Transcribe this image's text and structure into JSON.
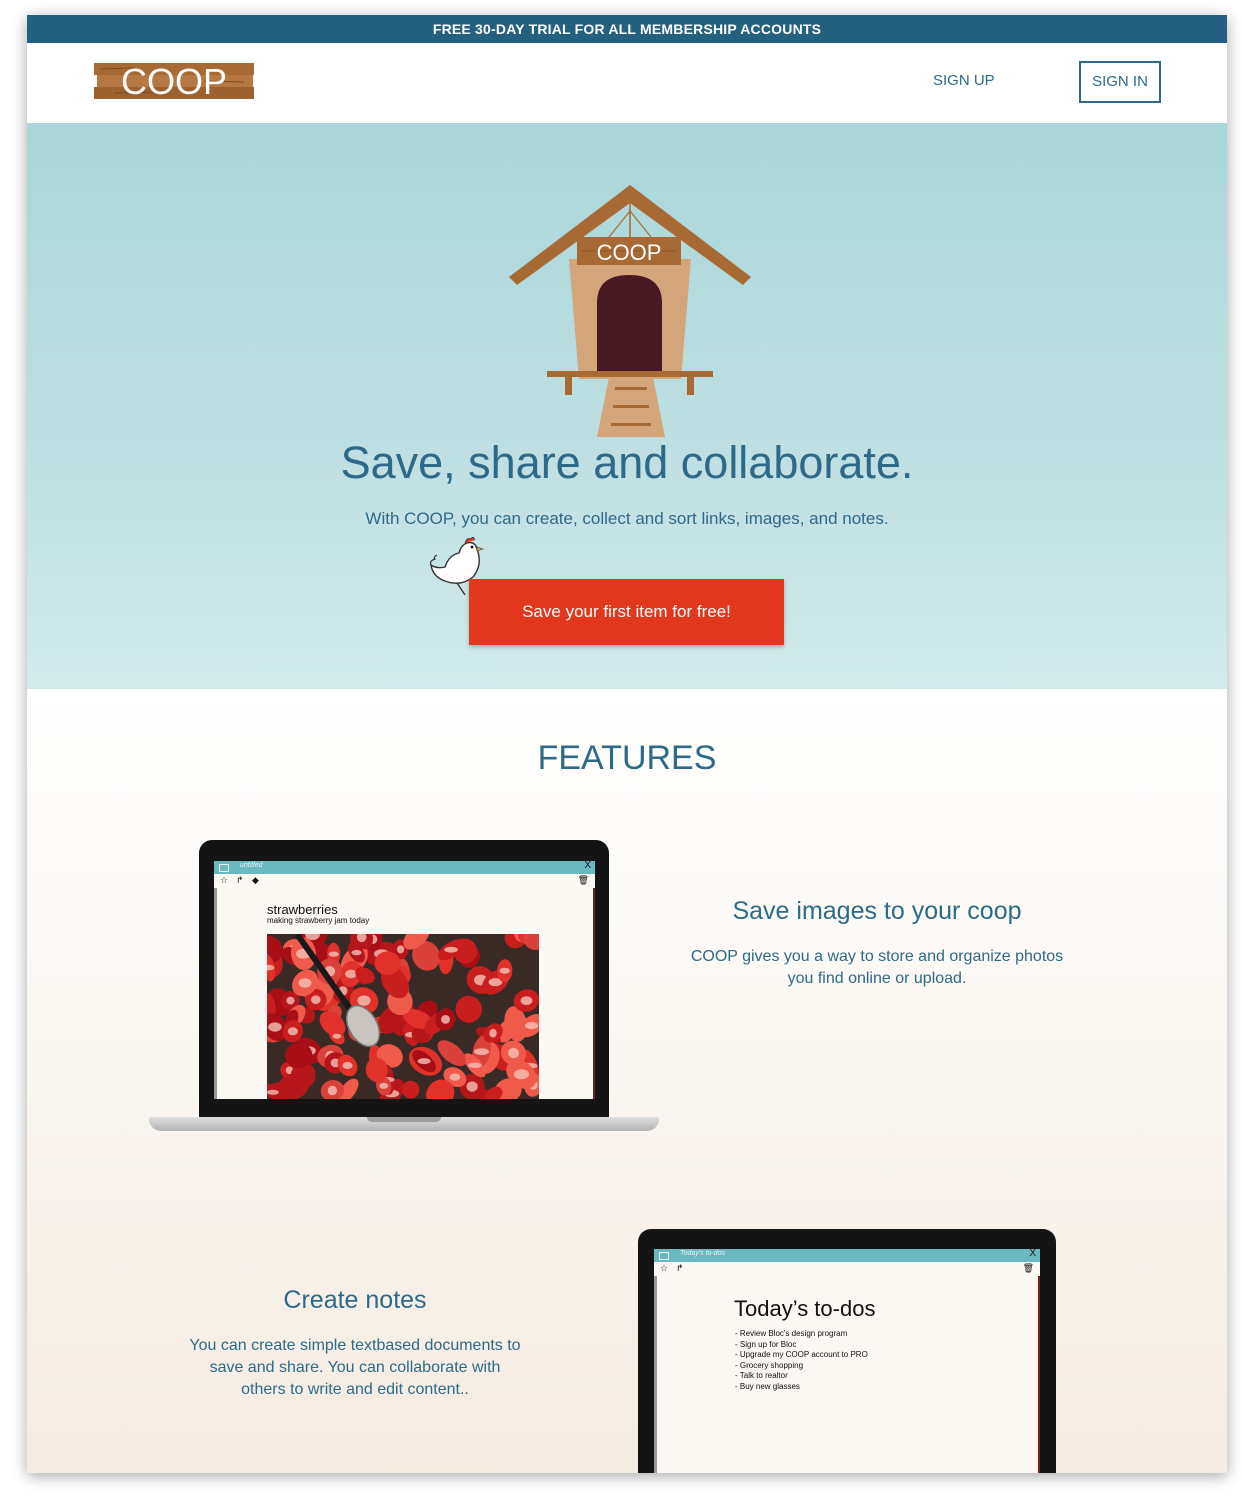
{
  "banner": {
    "text": "FREE 30-DAY TRIAL FOR ALL MEMBERSHIP ACCOUNTS"
  },
  "header": {
    "logo_text": "COOP",
    "signup_label": "SIGN UP",
    "signin_label": "SIGN IN"
  },
  "hero": {
    "house_sign": "COOP",
    "title": "Save, share and collaborate.",
    "subtitle": "With COOP, you can create, collect and sort links, images, and notes.",
    "cta_label": "Save your first item for free!"
  },
  "features": {
    "title": "FEATURES",
    "items": [
      {
        "heading": "Save images to your coop",
        "description": "COOP gives you a way to store and organize photos you find online or upload.",
        "screen": {
          "window_title": "untitled",
          "close": "X",
          "note_title": "strawberries",
          "note_subtitle": "making strawberry jam today"
        }
      },
      {
        "heading": "Create notes",
        "description": "You can create simple textbased documents to save and share. You can collaborate with others to write and edit content..",
        "screen": {
          "window_title": "Today's to-dos",
          "close": "X",
          "note_title": "Today’s to-dos",
          "todos": [
            "- Review Bloc's design program",
            "- Sign up for Bloc",
            "- Upgrade my COOP account to PRO",
            "- Grocery shopping",
            "- Talk to realtor",
            "- Buy new glasses"
          ]
        }
      }
    ]
  },
  "icons": [
    "coop-logo-icon",
    "chicken-coop-icon",
    "chicken-icon",
    "star-icon",
    "share-icon",
    "tag-icon",
    "trash-icon",
    "close-icon",
    "document-icon"
  ],
  "colors": {
    "banner": "#24607f",
    "brand_text": "#2d6a88",
    "hero_bg": "#a9d6d8",
    "cta": "#e2371d",
    "app_titlebar": "#6ab9bf",
    "wood": "#a76a35"
  }
}
